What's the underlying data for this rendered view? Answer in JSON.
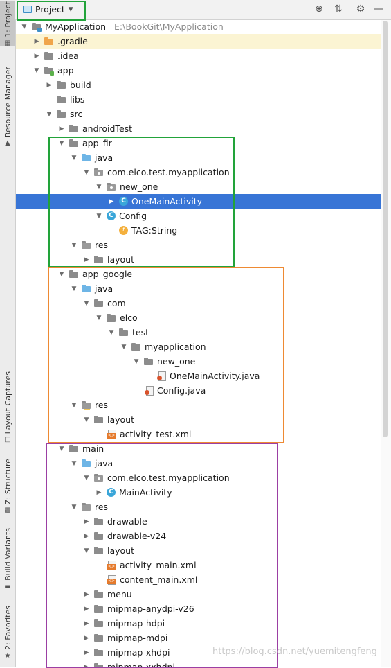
{
  "side_tabs": {
    "project": "1: Project",
    "resource_manager": "Resource Manager",
    "layout_captures": "Layout Captures",
    "structure": "Z: Structure",
    "build_variants": "Build Variants",
    "favorites": "2: Favorites"
  },
  "toolbar": {
    "view_label": "Project",
    "icons": [
      "locate-icon",
      "collapse-icon",
      "gear-icon",
      "minimize-icon"
    ]
  },
  "tree": [
    {
      "depth": 0,
      "arrow": "open",
      "icon": "project-folder",
      "label": "MyApplication",
      "path": "E:\\BookGit\\MyApplication"
    },
    {
      "depth": 1,
      "arrow": "closed",
      "icon": "folder-orange",
      "label": ".gradle",
      "highlight": true
    },
    {
      "depth": 1,
      "arrow": "closed",
      "icon": "folder",
      "label": ".idea"
    },
    {
      "depth": 1,
      "arrow": "open",
      "icon": "module-folder",
      "label": "app"
    },
    {
      "depth": 2,
      "arrow": "closed",
      "icon": "folder",
      "label": "build"
    },
    {
      "depth": 2,
      "arrow": "none",
      "icon": "folder",
      "label": "libs"
    },
    {
      "depth": 2,
      "arrow": "open",
      "icon": "folder",
      "label": "src"
    },
    {
      "depth": 3,
      "arrow": "closed",
      "icon": "folder",
      "label": "androidTest"
    },
    {
      "depth": 3,
      "arrow": "open",
      "icon": "folder",
      "label": "app_fir"
    },
    {
      "depth": 4,
      "arrow": "open",
      "icon": "folder-blue",
      "label": "java"
    },
    {
      "depth": 5,
      "arrow": "open",
      "icon": "package",
      "label": "com.elco.test.myapplication"
    },
    {
      "depth": 6,
      "arrow": "open",
      "icon": "package",
      "label": "new_one"
    },
    {
      "depth": 7,
      "arrow": "closed",
      "icon": "class",
      "label": "OneMainActivity",
      "selected": true
    },
    {
      "depth": 6,
      "arrow": "open",
      "icon": "class",
      "label": "Config"
    },
    {
      "depth": 7,
      "arrow": "none",
      "icon": "field",
      "label": "TAG:String"
    },
    {
      "depth": 4,
      "arrow": "open",
      "icon": "res-folder",
      "label": "res"
    },
    {
      "depth": 5,
      "arrow": "closed",
      "icon": "folder",
      "label": "layout"
    },
    {
      "depth": 3,
      "arrow": "open",
      "icon": "folder",
      "label": "app_google"
    },
    {
      "depth": 4,
      "arrow": "open",
      "icon": "folder-blue",
      "label": "java"
    },
    {
      "depth": 5,
      "arrow": "open",
      "icon": "folder",
      "label": "com"
    },
    {
      "depth": 6,
      "arrow": "open",
      "icon": "folder",
      "label": "elco"
    },
    {
      "depth": 7,
      "arrow": "open",
      "icon": "folder",
      "label": "test"
    },
    {
      "depth": 8,
      "arrow": "open",
      "icon": "folder",
      "label": "myapplication"
    },
    {
      "depth": 9,
      "arrow": "open",
      "icon": "folder",
      "label": "new_one"
    },
    {
      "depth": 10,
      "arrow": "none",
      "icon": "java-file",
      "label": "OneMainActivity.java"
    },
    {
      "depth": 9,
      "arrow": "none",
      "icon": "java-file",
      "label": "Config.java"
    },
    {
      "depth": 4,
      "arrow": "open",
      "icon": "res-folder",
      "label": "res"
    },
    {
      "depth": 5,
      "arrow": "open",
      "icon": "folder",
      "label": "layout"
    },
    {
      "depth": 6,
      "arrow": "none",
      "icon": "xml-file",
      "label": "activity_test.xml"
    },
    {
      "depth": 3,
      "arrow": "open",
      "icon": "folder",
      "label": "main"
    },
    {
      "depth": 4,
      "arrow": "open",
      "icon": "folder-blue",
      "label": "java"
    },
    {
      "depth": 5,
      "arrow": "open",
      "icon": "package",
      "label": "com.elco.test.myapplication"
    },
    {
      "depth": 6,
      "arrow": "closed",
      "icon": "class",
      "label": "MainActivity"
    },
    {
      "depth": 4,
      "arrow": "open",
      "icon": "res-folder",
      "label": "res"
    },
    {
      "depth": 5,
      "arrow": "closed",
      "icon": "folder",
      "label": "drawable"
    },
    {
      "depth": 5,
      "arrow": "closed",
      "icon": "folder",
      "label": "drawable-v24"
    },
    {
      "depth": 5,
      "arrow": "open",
      "icon": "folder",
      "label": "layout"
    },
    {
      "depth": 6,
      "arrow": "none",
      "icon": "xml-file",
      "label": "activity_main.xml"
    },
    {
      "depth": 6,
      "arrow": "none",
      "icon": "xml-file",
      "label": "content_main.xml"
    },
    {
      "depth": 5,
      "arrow": "closed",
      "icon": "folder",
      "label": "menu"
    },
    {
      "depth": 5,
      "arrow": "closed",
      "icon": "folder",
      "label": "mipmap-anydpi-v26"
    },
    {
      "depth": 5,
      "arrow": "closed",
      "icon": "folder",
      "label": "mipmap-hdpi"
    },
    {
      "depth": 5,
      "arrow": "closed",
      "icon": "folder",
      "label": "mipmap-mdpi"
    },
    {
      "depth": 5,
      "arrow": "closed",
      "icon": "folder",
      "label": "mipmap-xhdpi"
    },
    {
      "depth": 5,
      "arrow": "closed",
      "icon": "folder",
      "label": "mipmap-xxhdpi"
    }
  ],
  "annotation_colors": {
    "toolbar_box": "#22a33a",
    "app_fir_box": "#22a33a",
    "app_google_box": "#ee8a33",
    "main_box": "#9b3fa3"
  },
  "watermark": "https://blog.csdn.net/yuemitengfeng"
}
